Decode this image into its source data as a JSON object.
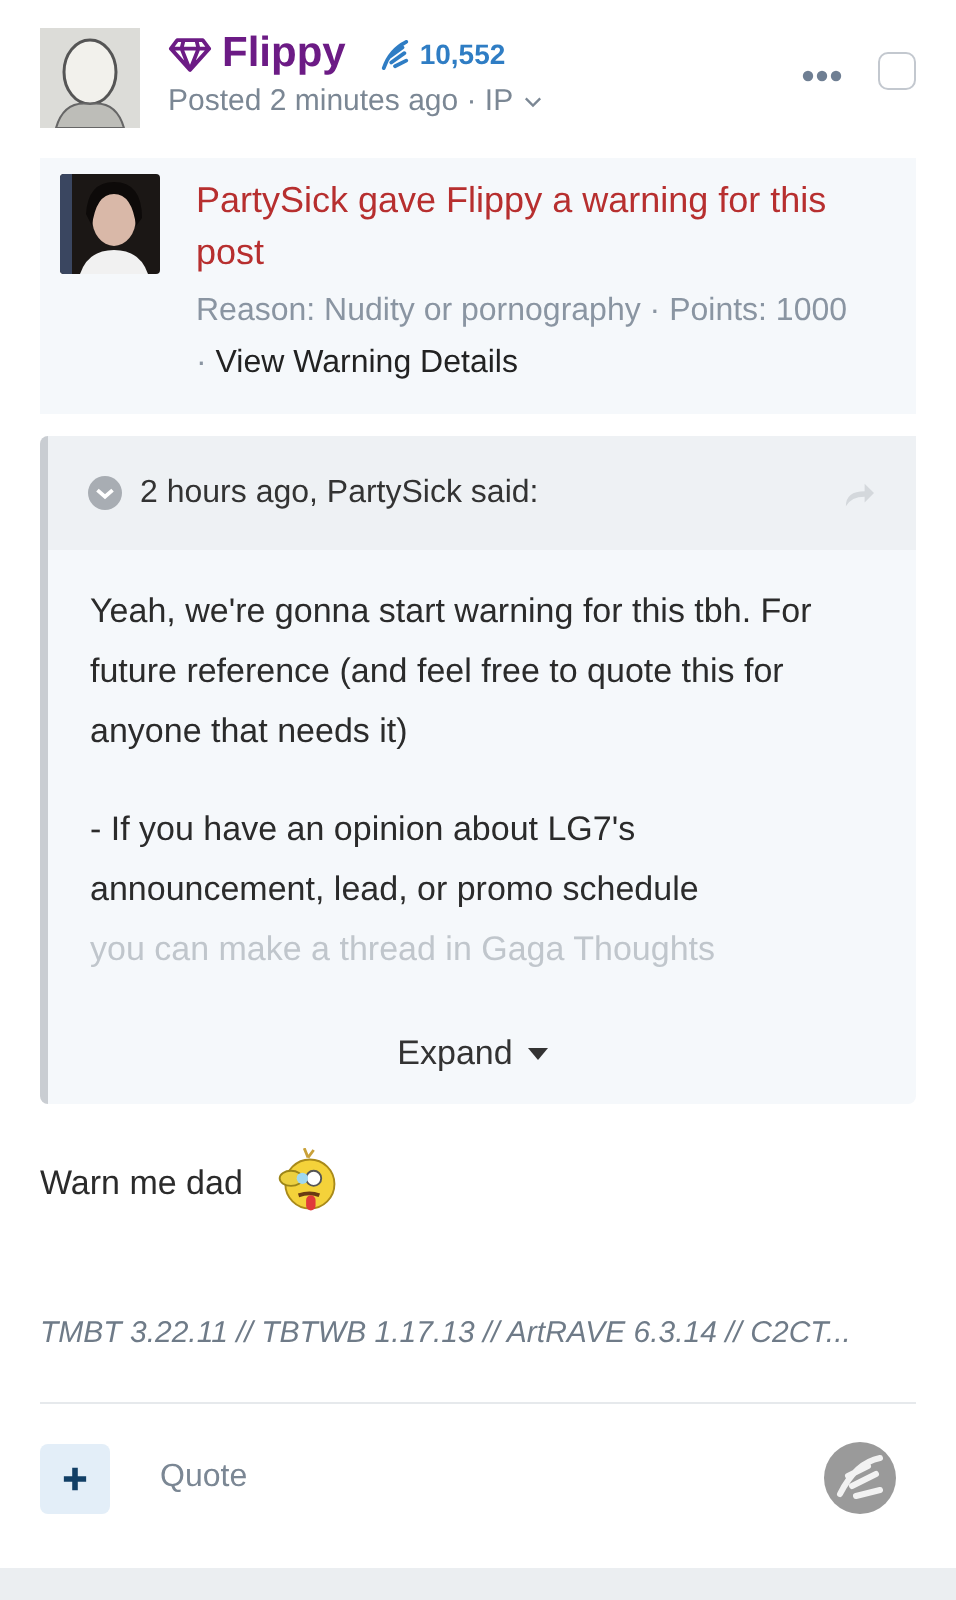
{
  "post": {
    "author": "Flippy",
    "reputation": "10,552",
    "posted": "Posted 2 minutes ago · IP",
    "selected": false
  },
  "warning": {
    "title": "PartySick gave Flippy a warning for this post",
    "reason": "Reason: Nudity or pornography · Points: 1000 ·",
    "link": "View Warning Details"
  },
  "quote": {
    "citation": "2 hours ago, PartySick said:",
    "paragraphs": [
      {
        "lines": [
          {
            "text": "Yeah, we're gonna start warning for this tbh. For future reference (and feel free to quote this for anyone that needs it)",
            "faded": false
          }
        ]
      },
      {
        "lines": [
          {
            "text": " - If you have an opinion about LG7's announcement, lead, or promo schedule",
            "faded": false
          },
          {
            "text": "you can make a thread in Gaga Thoughts",
            "faded": true
          }
        ]
      }
    ],
    "expand": "Expand"
  },
  "message": "Warn me dad",
  "signature": "TMBT 3.22.11 // TBTWB 1.17.13 // ArtRAVE 6.3.14 // C2CT...",
  "actions": {
    "quote": "Quote"
  }
}
